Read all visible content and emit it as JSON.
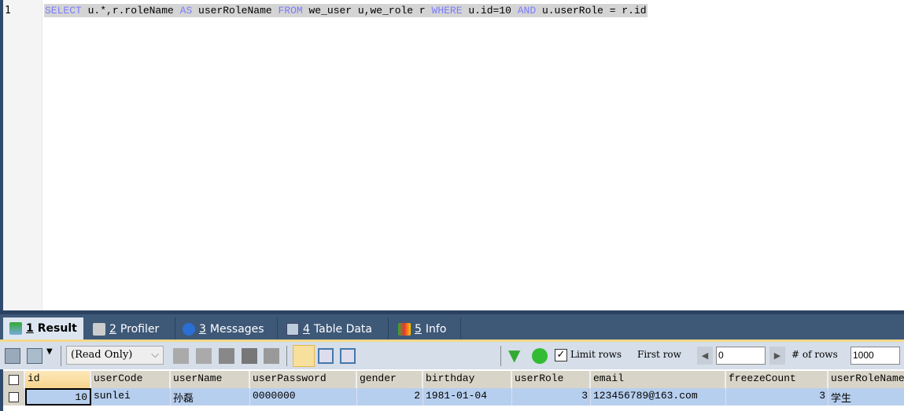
{
  "editor": {
    "line_number": "1",
    "sql": [
      {
        "t": "SELECT",
        "kw": true
      },
      {
        "t": " u.*,r.roleName ",
        "kw": false
      },
      {
        "t": "AS",
        "kw": true
      },
      {
        "t": " userRoleName ",
        "kw": false
      },
      {
        "t": "FROM",
        "kw": true
      },
      {
        "t": " we_user u,we_role r ",
        "kw": false
      },
      {
        "t": "WHERE",
        "kw": true
      },
      {
        "t": " u.id=10 ",
        "kw": false
      },
      {
        "t": "AND",
        "kw": true
      },
      {
        "t": " u.userRole = r.id",
        "kw": false
      }
    ]
  },
  "tabs": [
    {
      "num": "1",
      "label": "Result",
      "active": true
    },
    {
      "num": "2",
      "label": "Profiler"
    },
    {
      "num": "3",
      "label": "Messages"
    },
    {
      "num": "4",
      "label": "Table Data"
    },
    {
      "num": "5",
      "label": "Info"
    }
  ],
  "toolbar": {
    "mode": "(Read Only)",
    "limit_rows_label": "Limit rows",
    "limit_rows_checked": true,
    "first_row_label": "First row",
    "first_row_value": "0",
    "num_rows_label": "# of rows",
    "num_rows_value": "1000"
  },
  "grid": {
    "columns": [
      "id",
      "userCode",
      "userName",
      "userPassword",
      "gender",
      "birthday",
      "userRole",
      "email",
      "freezeCount",
      "userRoleName"
    ],
    "rows": [
      [
        "10",
        "sunlei",
        "孙磊",
        "0000000",
        "2",
        "1981-01-04",
        "3",
        "123456789@163.com",
        "3",
        "学生"
      ]
    ]
  },
  "colors": {
    "tabbar": "#3e5878",
    "keyword": "#7b7bff",
    "selected_row": "#b7cfee",
    "header": "#d8d4c8"
  }
}
